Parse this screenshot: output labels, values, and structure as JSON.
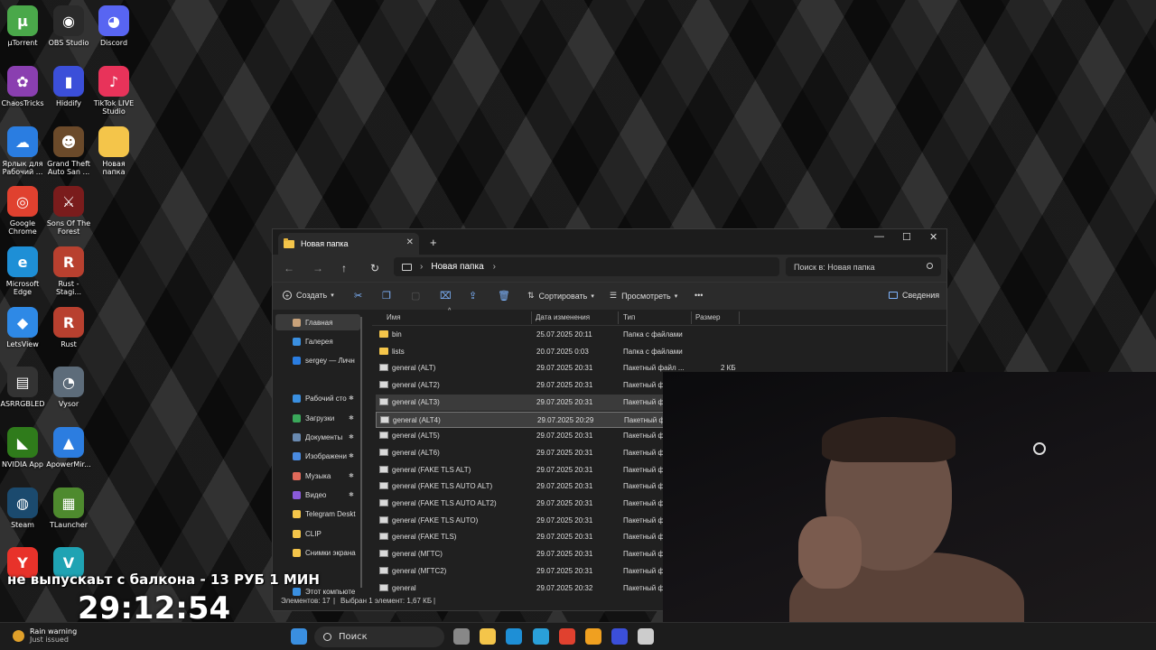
{
  "desktop": {
    "icons": [
      {
        "label": "µTorrent",
        "glyph": "µ",
        "color": "#4aa84a"
      },
      {
        "label": "OBS Studio",
        "glyph": "◉",
        "color": "#2a2a2a"
      },
      {
        "label": "Discord",
        "glyph": "◕",
        "color": "#5865f2"
      },
      {
        "label": "ChaosTricks",
        "glyph": "✿",
        "color": "#8a3fb0"
      },
      {
        "label": "Hiddify",
        "glyph": "▮",
        "color": "#3b4fd9"
      },
      {
        "label": "TikTok LIVE Studio",
        "glyph": "♪",
        "color": "#e8335a"
      },
      {
        "label": "Ярлык для Рабочий ...",
        "glyph": "☁",
        "color": "#2a7de1"
      },
      {
        "label": "Grand Theft Auto San ...",
        "glyph": "☻",
        "color": "#6b4a2a"
      },
      {
        "label": "Новая папка",
        "glyph": "",
        "color": "#f4c54a"
      },
      {
        "label": "Google Chrome",
        "glyph": "◎",
        "color": "#e0412f"
      },
      {
        "label": "Sons Of The Forest",
        "glyph": "⚔",
        "color": "#7a1c1c"
      },
      {
        "label": "Microsoft Edge",
        "glyph": "e",
        "color": "#1e8fd6"
      },
      {
        "label": "Rust - Stagi...",
        "glyph": "R",
        "color": "#b8402f"
      },
      {
        "label": "LetsView",
        "glyph": "◆",
        "color": "#2e89e6"
      },
      {
        "label": "Rust",
        "glyph": "R",
        "color": "#b8402f"
      },
      {
        "label": "ASRRGBLED",
        "glyph": "▤",
        "color": "#333333"
      },
      {
        "label": "Vysor",
        "glyph": "◔",
        "color": "#5d6c7a"
      },
      {
        "label": "NVIDIA App",
        "glyph": "◣",
        "color": "#2f7b1b"
      },
      {
        "label": "ApowerMir...",
        "glyph": "▲",
        "color": "#2c7de0"
      },
      {
        "label": "Steam",
        "glyph": "◍",
        "color": "#1b4a6e"
      },
      {
        "label": "TLauncher",
        "glyph": "▦",
        "color": "#4e8a2e"
      },
      {
        "label": "",
        "glyph": "Y",
        "color": "#e8322a"
      },
      {
        "label": "",
        "glyph": "V",
        "color": "#1fa3b3"
      }
    ]
  },
  "window": {
    "tab_title": "Новая папка",
    "tab_close": "✕",
    "tab_new": "+",
    "minimize": "—",
    "maximize": "☐",
    "close": "✕",
    "nav_back": "←",
    "nav_forward": "→",
    "nav_up": "↑",
    "nav_refresh": "↻",
    "breadcrumb": "Новая папка",
    "breadcrumb_chevron_1": "›",
    "breadcrumb_chevron_2": "›",
    "search_placeholder": "Поиск в: Новая папка",
    "toolbar": {
      "create": "Создать",
      "sort": "Сортировать",
      "view": "Просмотреть",
      "more": "•••",
      "details": "Сведения"
    },
    "nav_pane": [
      {
        "label": "Главная",
        "color": "#c8a27a",
        "selected": true,
        "pinned": false
      },
      {
        "label": "Галерея",
        "color": "#3a8fe0",
        "selected": false,
        "pinned": false
      },
      {
        "label": "sergey — Личн",
        "color": "#2a7de1",
        "selected": false,
        "pinned": false
      },
      {
        "label": "Рабочий сто",
        "color": "#3a8fe0",
        "selected": false,
        "pinned": true
      },
      {
        "label": "Загрузки",
        "color": "#3aa85a",
        "selected": false,
        "pinned": true
      },
      {
        "label": "Документы",
        "color": "#6a8ab0",
        "selected": false,
        "pinned": true
      },
      {
        "label": "Изображени",
        "color": "#4a8be0",
        "selected": false,
        "pinned": true
      },
      {
        "label": "Музыка",
        "color": "#e06a5a",
        "selected": false,
        "pinned": true
      },
      {
        "label": "Видео",
        "color": "#8a5ad9",
        "selected": false,
        "pinned": true
      },
      {
        "label": "Telegram Deskt",
        "color": "#f4c54a",
        "selected": false,
        "pinned": false
      },
      {
        "label": "CLIP",
        "color": "#f4c54a",
        "selected": false,
        "pinned": false
      },
      {
        "label": "Снимки экрана",
        "color": "#f4c54a",
        "selected": false,
        "pinned": false
      },
      {
        "label": "Этот компьюте",
        "color": "#3a8fe0",
        "selected": false,
        "pinned": false
      }
    ],
    "columns": {
      "name": "Имя",
      "date": "Дата изменения",
      "type": "Тип",
      "size": "Размер"
    },
    "files": [
      {
        "name": "bin",
        "date": "25.07.2025 20:11",
        "type": "Папка с файлами",
        "size": "",
        "kind": "folder"
      },
      {
        "name": "lists",
        "date": "20.07.2025 0:03",
        "type": "Папка с файлами",
        "size": "",
        "kind": "folder"
      },
      {
        "name": "general (ALT)",
        "date": "29.07.2025 20:31",
        "type": "Пакетный файл ...",
        "size": "2 КБ",
        "kind": "bat"
      },
      {
        "name": "general (ALT2)",
        "date": "29.07.2025 20:31",
        "type": "Пакетный ф",
        "size": "",
        "kind": "bat"
      },
      {
        "name": "general (ALT3)",
        "date": "29.07.2025 20:31",
        "type": "Пакетный ф",
        "size": "",
        "kind": "bat"
      },
      {
        "name": "general (ALT4)",
        "date": "29.07.2025 20:29",
        "type": "Пакетный ф",
        "size": "",
        "kind": "bat"
      },
      {
        "name": "general (ALT5)",
        "date": "29.07.2025 20:31",
        "type": "Пакетный ф",
        "size": "",
        "kind": "bat"
      },
      {
        "name": "general (ALT6)",
        "date": "29.07.2025 20:31",
        "type": "Пакетный ф",
        "size": "",
        "kind": "bat"
      },
      {
        "name": "general (FAKE TLS ALT)",
        "date": "29.07.2025 20:31",
        "type": "Пакетный ф",
        "size": "",
        "kind": "bat"
      },
      {
        "name": "general (FAKE TLS AUTO ALT)",
        "date": "29.07.2025 20:31",
        "type": "Пакетный ф",
        "size": "",
        "kind": "bat"
      },
      {
        "name": "general (FAKE TLS AUTO ALT2)",
        "date": "29.07.2025 20:31",
        "type": "Пакетный ф",
        "size": "",
        "kind": "bat"
      },
      {
        "name": "general (FAKE TLS AUTO)",
        "date": "29.07.2025 20:31",
        "type": "Пакетный ф",
        "size": "",
        "kind": "bat"
      },
      {
        "name": "general (FAKE TLS)",
        "date": "29.07.2025 20:31",
        "type": "Пакетный ф",
        "size": "",
        "kind": "bat"
      },
      {
        "name": "general (МГТС)",
        "date": "29.07.2025 20:31",
        "type": "Пакетный ф",
        "size": "",
        "kind": "bat"
      },
      {
        "name": "general (МГТС2)",
        "date": "29.07.2025 20:31",
        "type": "Пакетный ф",
        "size": "",
        "kind": "bat"
      },
      {
        "name": "general",
        "date": "29.07.2025 20:32",
        "type": "Пакетный ф",
        "size": "",
        "kind": "bat"
      }
    ],
    "hovered_file": "general (ALT3)",
    "selected_file": "general (ALT4)",
    "status_count": "Элементов: 17",
    "status_sep1": "|",
    "status_selected": "Выбран 1 элемент: 1,67 КБ",
    "status_sep2": "|"
  },
  "overlay": {
    "donation_line": "не выпускаьт с балкона - 13 РУБ 1 МИН",
    "timer": "29:12:54"
  },
  "taskbar": {
    "weather_title": "Rain warning",
    "weather_sub": "Just issued",
    "search_label": "Поиск",
    "apps": [
      {
        "name": "start-button",
        "color": "#3a8fe0"
      },
      {
        "name": "task-view-button",
        "color": "#888888"
      },
      {
        "name": "file-explorer-button",
        "color": "#f4c54a"
      },
      {
        "name": "edge-button",
        "color": "#1e8fd6"
      },
      {
        "name": "telegram-button",
        "color": "#2aa0d9"
      },
      {
        "name": "chrome-button",
        "color": "#e0412f"
      },
      {
        "name": "app-yellow-button",
        "color": "#f0a020"
      },
      {
        "name": "hiddify-button",
        "color": "#3b4fd9"
      },
      {
        "name": "tool-button",
        "color": "#cccccc"
      }
    ]
  }
}
